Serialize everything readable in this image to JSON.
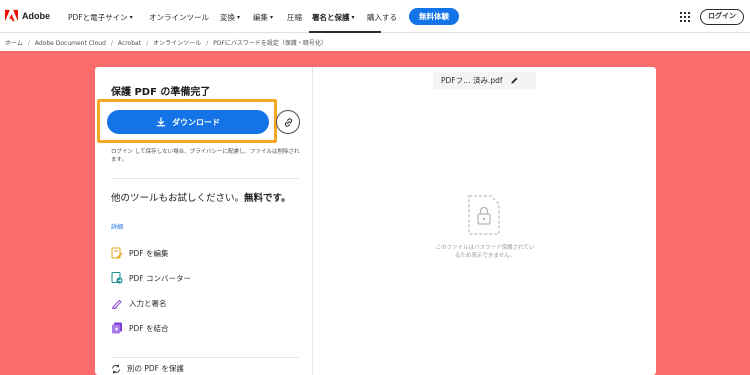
{
  "brand": {
    "name": "Adobe",
    "color": "#eb1000"
  },
  "nav": {
    "items": [
      {
        "label": "PDFと電子サイン",
        "has_dropdown": true
      },
      {
        "label": "オンラインツール",
        "has_dropdown": false
      },
      {
        "label": "変換",
        "has_dropdown": true
      },
      {
        "label": "編集",
        "has_dropdown": true
      },
      {
        "label": "圧縮",
        "has_dropdown": false
      },
      {
        "label": "署名と保護",
        "has_dropdown": true,
        "active": true
      },
      {
        "label": "購入する",
        "has_dropdown": false
      }
    ],
    "trial_button": "無料体験",
    "apps_icon": "grid-icon",
    "login_button": "ログイン"
  },
  "breadcrumb": [
    "ホーム",
    "Adobe Document Cloud",
    "Acrobat",
    "オンラインツール",
    "PDFにパスワードを設定（保護・暗号化）"
  ],
  "result": {
    "title": "保護 PDF の準備完了",
    "download_label": "ダウンロード",
    "share_icon": "link-icon",
    "note": "ログイン して保存しない場合、プライバシーに配慮し、ファイルは削除されます。"
  },
  "promo": {
    "title_prefix": "他のツールもお試しください。",
    "title_bold": "無料です。",
    "detail_link": "詳細"
  },
  "tools": [
    {
      "label": "PDF を編集",
      "icon": "edit-pdf-icon"
    },
    {
      "label": "PDF コンバーター",
      "icon": "convert-pdf-icon"
    },
    {
      "label": "入力と署名",
      "icon": "fill-sign-icon"
    },
    {
      "label": "PDF を結合",
      "icon": "combine-pdf-icon"
    }
  ],
  "protect_another": {
    "label": "別の PDF を保護",
    "icon": "refresh-icon"
  },
  "preview": {
    "filename": "PDFフ…  済み.pdf",
    "edit_icon": "pencil-icon",
    "locked_message": "このファイルはパスワード保護されているため表示できません。"
  },
  "colors": {
    "accent_blue": "#1473e6",
    "hero_background": "#fa6b6b",
    "highlight_orange": "#f5a623"
  }
}
